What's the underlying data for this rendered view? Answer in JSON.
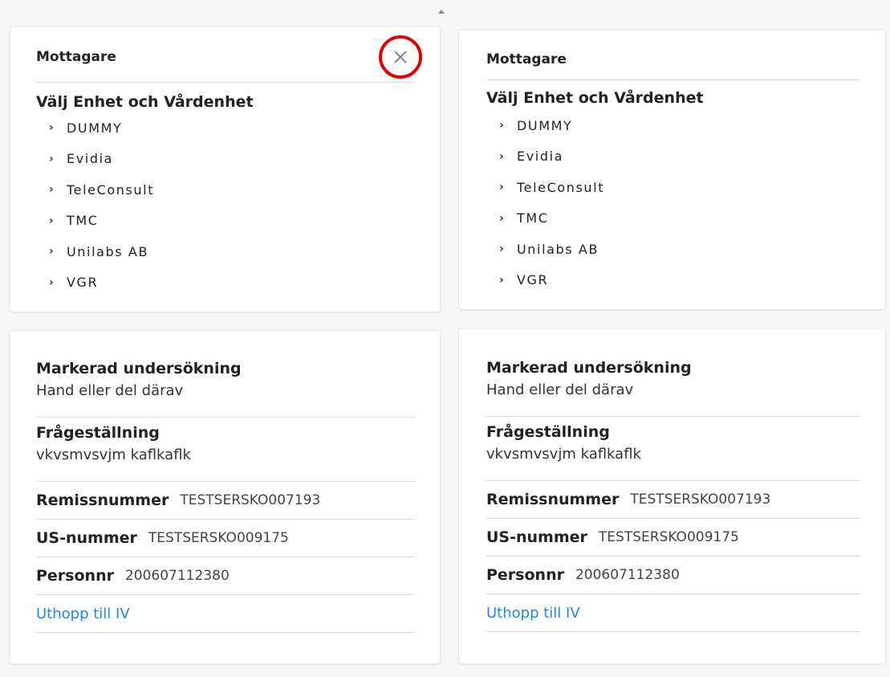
{
  "left": {
    "recipient": {
      "title": "Mottagare",
      "section_title": "Välj Enhet och Vårdenhet",
      "units": [
        {
          "label": "DUMMY"
        },
        {
          "label": "Evidia"
        },
        {
          "label": "TeleConsult"
        },
        {
          "label": "TMC"
        },
        {
          "label": "Unilabs AB"
        },
        {
          "label": "VGR"
        }
      ],
      "close_glyph": "×",
      "highlight_color": "#e00000"
    },
    "details": {
      "exam_label": "Markerad undersökning",
      "exam_value": "Hand eller del därav",
      "question_label": "Frågeställning",
      "question_value": "vkvsmvsvjm kaflkaflk",
      "referral_label": "Remissnummer",
      "referral_value": "TESTSERSKO007193",
      "us_label": "US-nummer",
      "us_value": "TESTSERSKO009175",
      "person_label": "Personnr",
      "person_value": "200607112380",
      "link_label": "Uthopp till IV"
    }
  },
  "right": {
    "recipient": {
      "title": "Mottagare",
      "section_title": "Välj Enhet och Vårdenhet",
      "units": [
        {
          "label": "DUMMY"
        },
        {
          "label": "Evidia"
        },
        {
          "label": "TeleConsult"
        },
        {
          "label": "TMC"
        },
        {
          "label": "Unilabs AB"
        },
        {
          "label": "VGR"
        }
      ]
    },
    "details": {
      "exam_label": "Markerad undersökning",
      "exam_value": "Hand eller del därav",
      "question_label": "Frågeställning",
      "question_value": "vkvsmvsvjm kaflkaflk",
      "referral_label": "Remissnummer",
      "referral_value": "TESTSERSKO007193",
      "us_label": "US-nummer",
      "us_value": "TESTSERSKO009175",
      "person_label": "Personnr",
      "person_value": "200607112380",
      "link_label": "Uthopp till IV"
    }
  },
  "colors": {
    "link": "#1e88e5",
    "highlight": "#e00000"
  },
  "icons": {
    "chevron": "›",
    "close": "close-icon"
  }
}
